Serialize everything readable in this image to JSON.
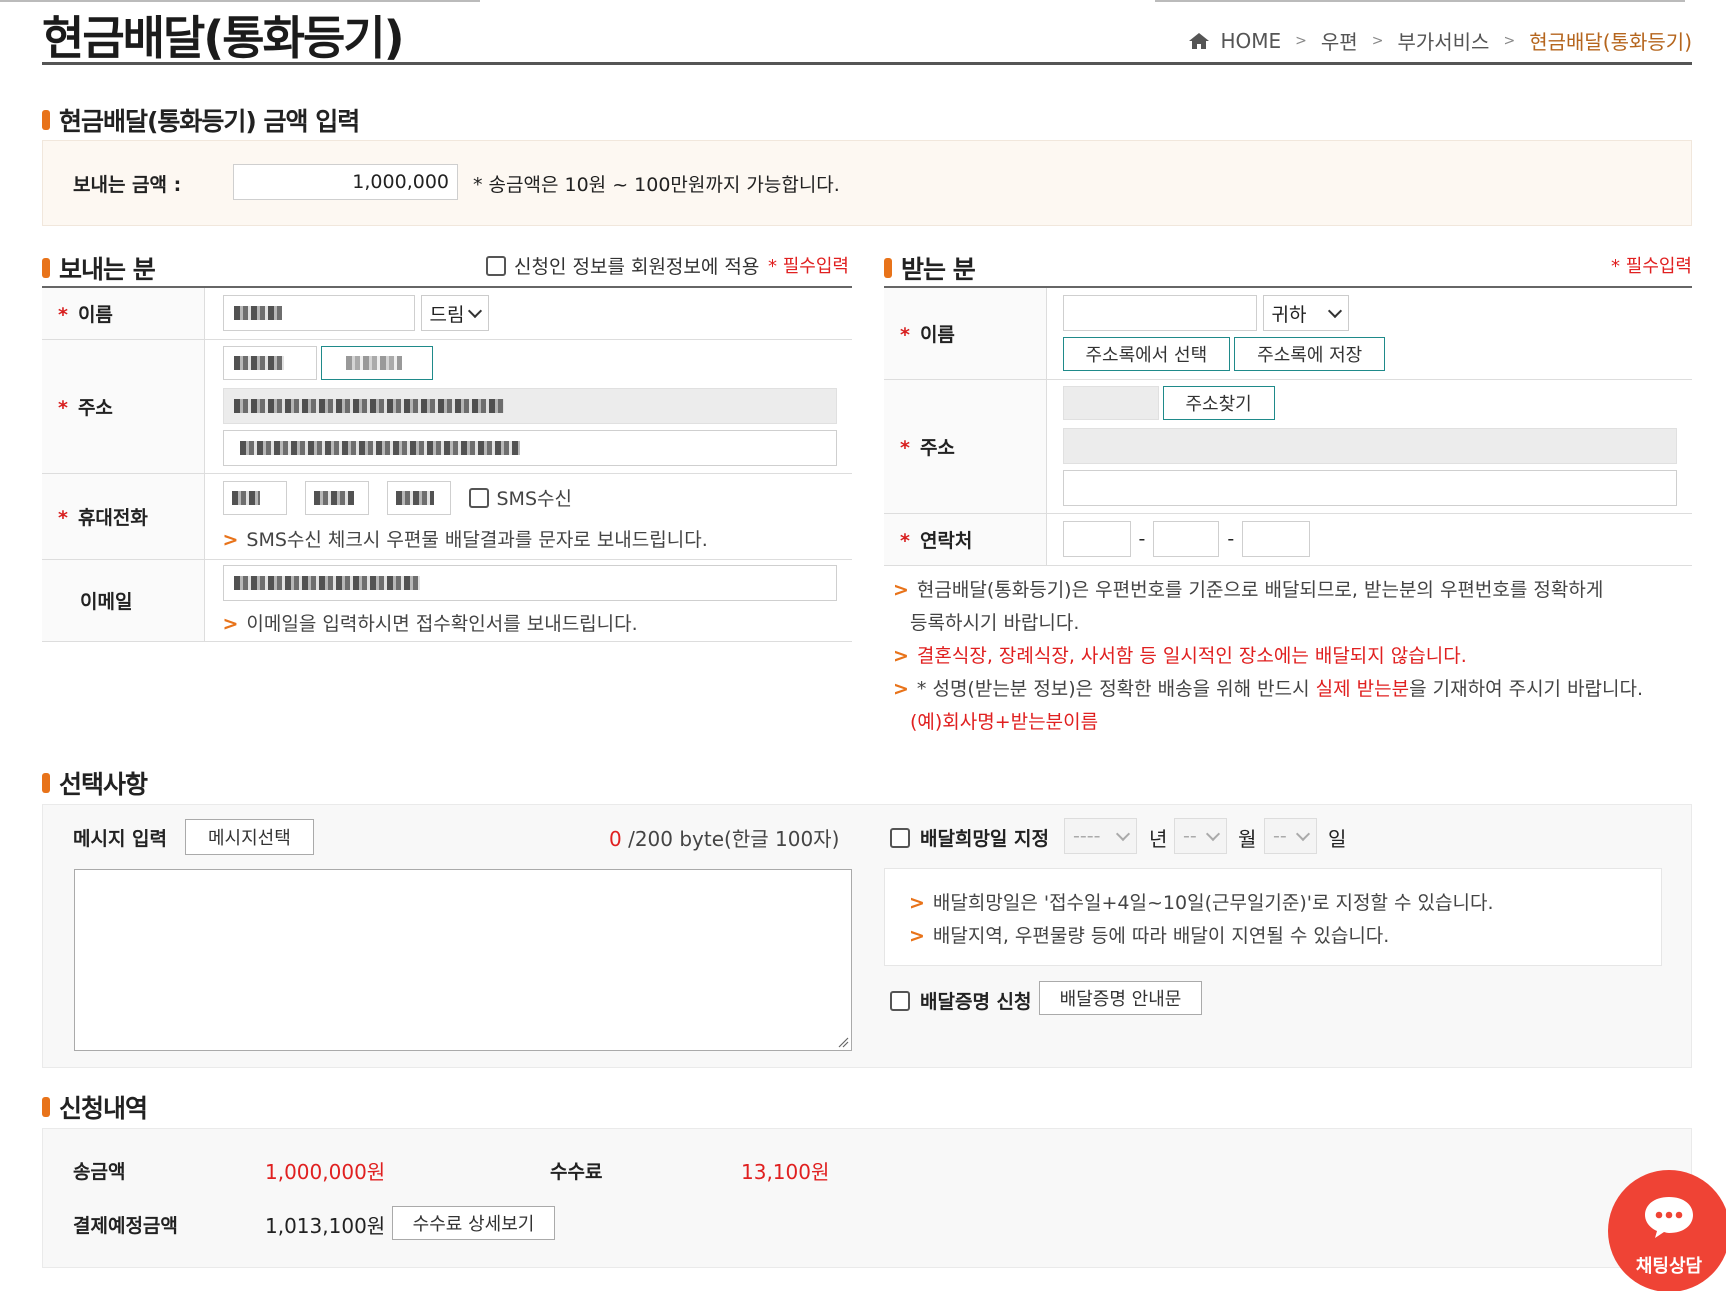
{
  "header": {
    "page_title": "현금배달(통화등기)",
    "breadcrumb": [
      "HOME",
      "우편",
      "부가서비스",
      "현금배달(통화등기)"
    ]
  },
  "amount_section": {
    "title": "현금배달(통화등기) 금액 입력",
    "label": "보내는 금액 :",
    "value": "1,000,000",
    "note": "* 송금액은 10원 ~ 100만원까지 가능합니다."
  },
  "sender": {
    "title": "보내는 분",
    "apply_member_label": "신청인 정보를 회원정보에 적용",
    "required_label": "* 필수입력",
    "name_label": "이름",
    "name_suffix": "드림",
    "address_label": "주소",
    "phone_label": "휴대전화",
    "sms_label": "SMS수신",
    "sms_note": "SMS수신 체크시 우편물 배달결과를 문자로 보내드립니다.",
    "email_label": "이메일",
    "email_note": "이메일을 입력하시면 접수확인서를 보내드립니다."
  },
  "receiver": {
    "title": "받는 분",
    "required_label": "* 필수입력",
    "name_label": "이름",
    "name_suffix": "귀하",
    "addressbook_select": "주소록에서 선택",
    "addressbook_save": "주소록에 저장",
    "address_label": "주소",
    "address_search": "주소찾기",
    "contact_label": "연락처",
    "dash": "-",
    "notes": {
      "n1a": "현금배달(통화등기)은 우편번호를 기준으로 배달되므로, 받는분의 우편번호를 정확하게",
      "n1b": "등록하시기 바랍니다.",
      "n2": "결혼식장, 장례식장, 사서함 등 일시적인 장소에는 배달되지 않습니다.",
      "n3_pre": "* 성명(받는분 정보)은 정확한 배송을 위해 반드시 ",
      "n3_red": "실제 받는분",
      "n3_post": "을 기재하여 주시기 바랍니다.",
      "n4": "(예)회사명+받는분이름"
    }
  },
  "options": {
    "title": "선택사항",
    "message_label": "메시지 입력",
    "message_select_button": "메시지선택",
    "byte_count": "0",
    "byte_limit": "/200 byte(한글 100자)",
    "desired_date_label": "배달희망일 지정",
    "year_placeholder": "----",
    "month_placeholder": "--",
    "day_placeholder": "--",
    "year_unit": "년",
    "month_unit": "월",
    "day_unit": "일",
    "date_note1": "배달희망일은 '접수일+4일~10일(근무일기준)'로 지정할 수 있습니다.",
    "date_note2": "배달지역, 우편물량 등에 따라 배달이 지연될 수 있습니다.",
    "proof_label": "배달증명 신청",
    "proof_guide_button": "배달증명 안내문"
  },
  "history": {
    "title": "신청내역",
    "amount_label": "송금액",
    "amount_value": "1,000,000원",
    "fee_label": "수수료",
    "fee_value": "13,100원",
    "total_label": "결제예정금액",
    "total_value": "1,013,100원",
    "fee_detail_button": "수수료 상세보기"
  },
  "chat": {
    "label": "채팅상담"
  },
  "colors": {
    "accent": "#e8731a",
    "teal": "#1f8a8a",
    "red": "#e02020",
    "chat": "#ef4335",
    "breadcrumb_current": "#b5651d"
  }
}
